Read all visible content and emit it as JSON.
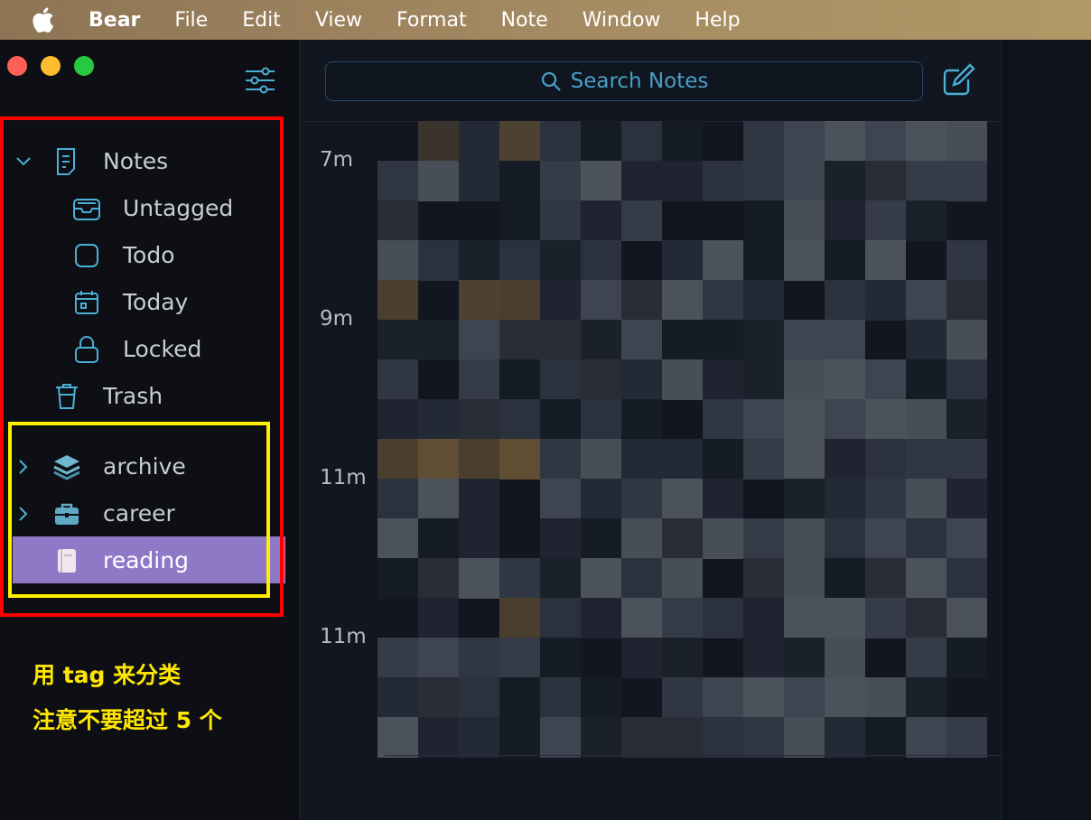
{
  "menubar": {
    "app_name": "Bear",
    "items": [
      "File",
      "Edit",
      "View",
      "Format",
      "Note",
      "Window",
      "Help"
    ]
  },
  "sidebar": {
    "notes_label": "Notes",
    "sub_items": [
      {
        "label": "Untagged",
        "icon": "inbox-icon"
      },
      {
        "label": "Todo",
        "icon": "checkbox-icon"
      },
      {
        "label": "Today",
        "icon": "calendar-icon"
      },
      {
        "label": "Locked",
        "icon": "lock-icon"
      }
    ],
    "trash_label": "Trash",
    "tags": [
      {
        "label": "archive",
        "icon": "layers-icon",
        "expandable": true
      },
      {
        "label": "career",
        "icon": "briefcase-icon",
        "expandable": true
      },
      {
        "label": "reading",
        "icon": "book-icon",
        "expandable": false,
        "selected": true
      }
    ]
  },
  "annotation": {
    "line1": "用 tag 来分类",
    "line2": "注意不要超过 5 个"
  },
  "notelist": {
    "search_placeholder": "Search Notes",
    "timestamps": [
      "7m",
      "9m",
      "11m",
      "11m"
    ]
  },
  "colors": {
    "accent": "#4b9fc7",
    "selected_tag": "#8f79c7",
    "annotation_red": "#ff0000",
    "annotation_yellow": "#ffef00"
  }
}
